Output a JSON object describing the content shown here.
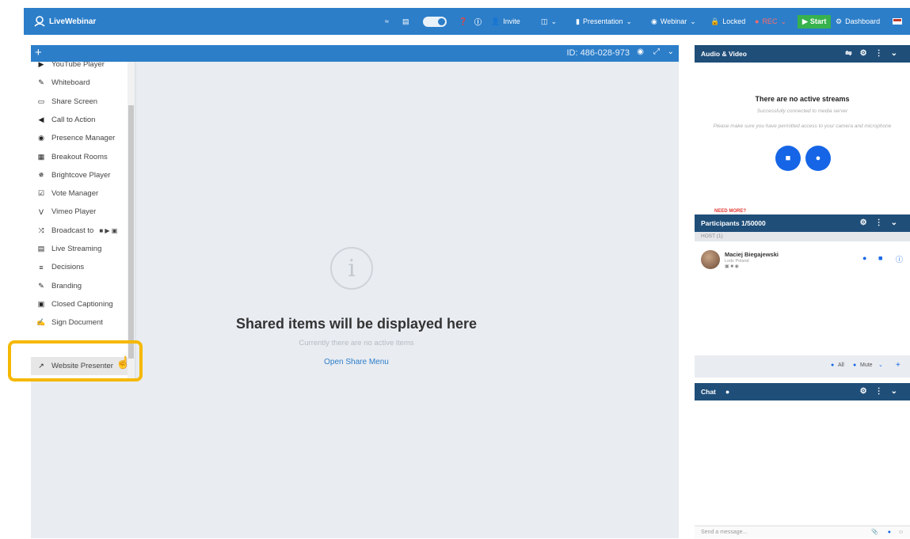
{
  "topbar": {
    "logo": "LiveWebinar",
    "invite": "Invite",
    "presentation": "Presentation",
    "webinar": "Webinar",
    "locked": "Locked",
    "rec": "REC",
    "start": "Start",
    "dashboard": "Dashboard"
  },
  "stage": {
    "session_id": "ID: 486-028-973",
    "empty_title": "Shared items will be displayed here",
    "empty_sub": "Currently there are no active items",
    "open_share": "Open Share Menu",
    "info_glyph": "i"
  },
  "share_menu": {
    "plus": "+",
    "items": [
      {
        "label": "YouTube Player",
        "icon": "youtube-icon"
      },
      {
        "label": "Whiteboard",
        "icon": "brush-icon"
      },
      {
        "label": "Share Screen",
        "icon": "monitor-icon"
      },
      {
        "label": "Call to Action",
        "icon": "megaphone-icon"
      },
      {
        "label": "Presence Manager",
        "icon": "eye-icon"
      },
      {
        "label": "Breakout Rooms",
        "icon": "grid-icon"
      },
      {
        "label": "Brightcove Player",
        "icon": "burst-icon"
      },
      {
        "label": "Vote Manager",
        "icon": "checkbox-icon"
      },
      {
        "label": "Vimeo Player",
        "icon": "vimeo-icon"
      },
      {
        "label": "Broadcast to",
        "icon": "shuffle-icon"
      },
      {
        "label": "Live Streaming",
        "icon": "stream-icon"
      },
      {
        "label": "Decisions",
        "icon": "list-icon"
      },
      {
        "label": "Branding",
        "icon": "brush-icon"
      },
      {
        "label": "Closed Captioning",
        "icon": "cc-icon"
      },
      {
        "label": "Sign Document",
        "icon": "sign-icon"
      },
      {
        "label": "Website Presenter",
        "icon": "external-link-icon"
      }
    ]
  },
  "audio_video": {
    "title": "Audio & Video",
    "no_streams": "There are no active streams",
    "connected": "Successfully connected to media server",
    "permission": "Please make sure you have permitted access to your camera and microphone"
  },
  "participants": {
    "need_more": "NEED MORE?",
    "title": "Participants 1/50000",
    "host_label": "HOST (1)",
    "name": "Maciej Biegajewski",
    "location": "Lodz Poland",
    "footer_all": "All",
    "footer_mute": "Mute"
  },
  "chat": {
    "title": "Chat",
    "placeholder": "Send a message..."
  }
}
